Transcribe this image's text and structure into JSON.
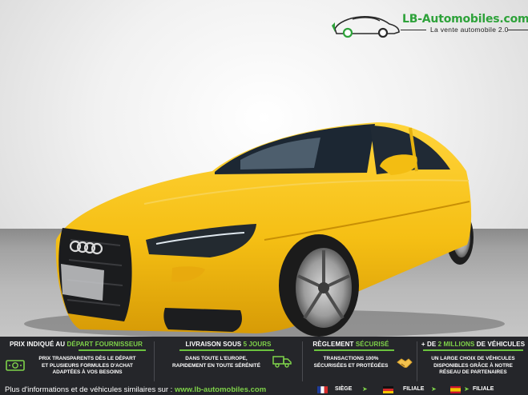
{
  "logo": {
    "name": "LB-Automobiles.com",
    "tagline": "La vente automobile 2.0",
    "icon": "car-logo-icon"
  },
  "photo": {
    "subject": "yellow-sedan",
    "colors": {
      "car": "#f7c21a",
      "floor": "#a4a4a4",
      "wall": "#eeeeee"
    }
  },
  "banner": {
    "colors": {
      "background": "#25262a",
      "accent": "#7fd34a"
    },
    "columns": [
      {
        "title_plain": "PRIX INDIQUÉ AU ",
        "title_highlight": "DÉPART FOURNISSEUR",
        "lines": [
          "PRIX TRANSPARENTS DÈS LE DÉPART",
          "ET PLUSIEURS FORMULES D'ACHAT",
          "ADAPTÉES À VOS BESOINS"
        ],
        "icon": "money-icon"
      },
      {
        "title_plain": "LIVRAISON SOUS ",
        "title_highlight": "5 JOURS",
        "lines": [
          "DANS TOUTE L'EUROPE,",
          "RAPIDEMENT EN TOUTE SÉRÉNITÉ"
        ],
        "icon": "delivery-truck-icon"
      },
      {
        "title_plain": "RÈGLEMENT ",
        "title_highlight": "SÉCURISÉ",
        "lines": [
          "TRANSACTIONS 100%",
          "SÉCURISÉES ET PROTÉGÉES"
        ],
        "icon": "handshake-icon"
      },
      {
        "title_plain": "+ DE ",
        "title_highlight": "2 MILLIONS",
        "title_suffix": " DE VÉHICULES",
        "lines": [
          "UN LARGE CHOIX DE VÉHICULES",
          "DISPONIBLES GRÂCE À NOTRE",
          "RÉSEAU DE PARTENAIRES"
        ],
        "icon": ""
      }
    ],
    "footer": {
      "text": "Plus d'informations et de véhicules similaires sur : ",
      "url": "www.lb-automobiles.com",
      "locations": [
        {
          "label": "SIÈGE",
          "flag": "france-flag-icon"
        },
        {
          "label": "FILIALE",
          "flag": "germany-flag-icon"
        },
        {
          "label": "FILIALE",
          "flag": "spain-flag-icon"
        }
      ]
    }
  }
}
